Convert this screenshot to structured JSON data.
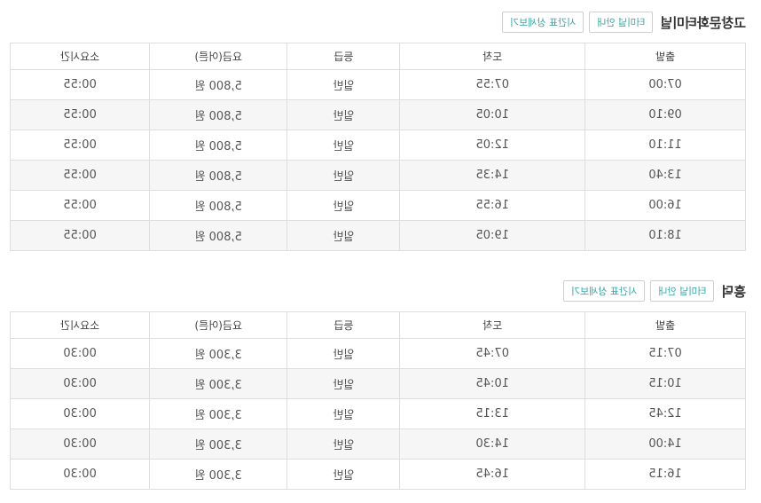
{
  "sections": [
    {
      "title": "고창문화터미널",
      "buttons": {
        "terminal_info": "터미널 안내",
        "timetable_detail": "시간표 상세보기"
      },
      "columns": [
        "출발",
        "도착",
        "등급",
        "요금(어른)",
        "소요시간"
      ],
      "rows": [
        [
          "07:00",
          "07:55",
          "일반",
          "5,800 원",
          "00:55"
        ],
        [
          "09:10",
          "10:05",
          "일반",
          "5,800 원",
          "00:55"
        ],
        [
          "11:10",
          "12:05",
          "일반",
          "5,800 원",
          "00:55"
        ],
        [
          "13:40",
          "14:35",
          "일반",
          "5,800 원",
          "00:55"
        ],
        [
          "16:00",
          "16:55",
          "일반",
          "5,800 원",
          "00:55"
        ],
        [
          "18:10",
          "19:05",
          "일반",
          "5,800 원",
          "00:55"
        ]
      ]
    },
    {
      "title": "흥덕",
      "buttons": {
        "terminal_info": "터미널 안내",
        "timetable_detail": "시간표 상세보기"
      },
      "columns": [
        "출발",
        "도착",
        "등급",
        "요금(어른)",
        "소요시간"
      ],
      "rows": [
        [
          "07:15",
          "07:45",
          "일반",
          "3,300 원",
          "00:30"
        ],
        [
          "10:15",
          "10:45",
          "일반",
          "3,300 원",
          "00:30"
        ],
        [
          "12:45",
          "13:15",
          "일반",
          "3,300 원",
          "00:30"
        ],
        [
          "14:00",
          "14:30",
          "일반",
          "3,300 원",
          "00:30"
        ],
        [
          "16:15",
          "16:45",
          "일반",
          "3,300 원",
          "00:30"
        ]
      ]
    }
  ]
}
